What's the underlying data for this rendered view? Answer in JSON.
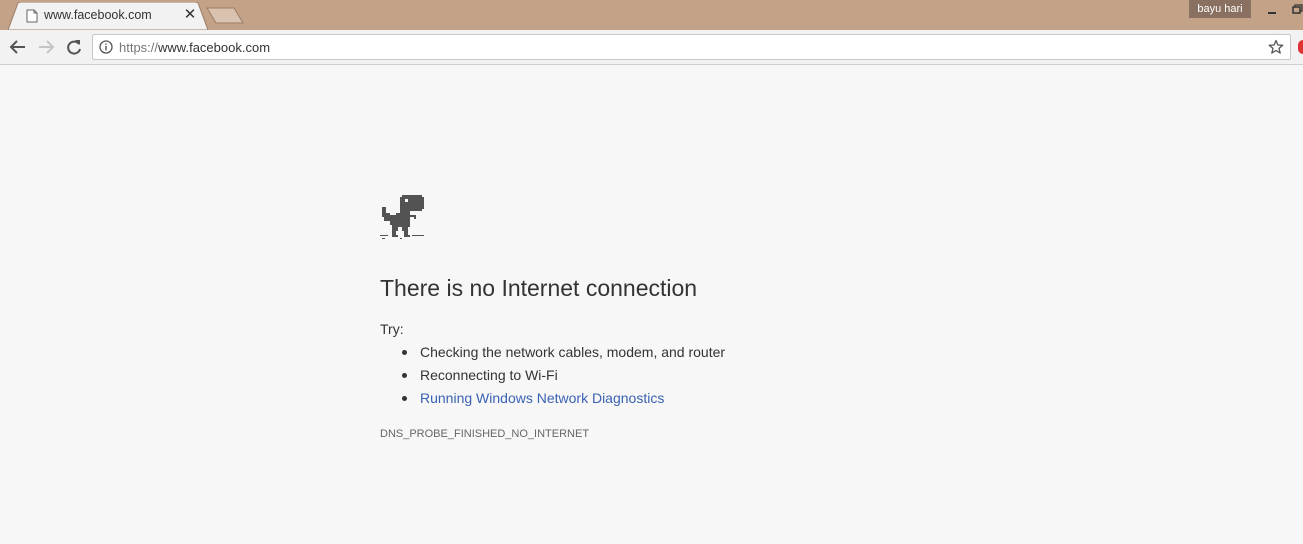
{
  "tab": {
    "title": "www.facebook.com",
    "close_glyph": "✕",
    "icons": {
      "favicon": "page-icon",
      "close": "close-icon"
    }
  },
  "profile": {
    "name": "bayu hari"
  },
  "window": {
    "icons": [
      "minimize-icon",
      "restore-icon"
    ]
  },
  "toolbar": {
    "icons": [
      "back-arrow-icon",
      "forward-arrow-icon",
      "reload-icon",
      "info-icon",
      "star-icon"
    ]
  },
  "omnibox": {
    "scheme": "https://",
    "host": "www.facebook.com"
  },
  "error_page": {
    "icon": "dino-icon",
    "headline": "There is no Internet connection",
    "try_label": "Try:",
    "suggestions": [
      "Checking the network cables, modem, and router",
      "Reconnecting to Wi-Fi",
      "Running Windows Network Diagnostics"
    ],
    "error_code": "DNS_PROBE_FINISHED_NO_INTERNET",
    "link_color": "#3a62b3"
  },
  "colors": {
    "titlebar": "#c4a287",
    "page_background": "#f7f7f7",
    "profile_badge": "#8a7060"
  }
}
